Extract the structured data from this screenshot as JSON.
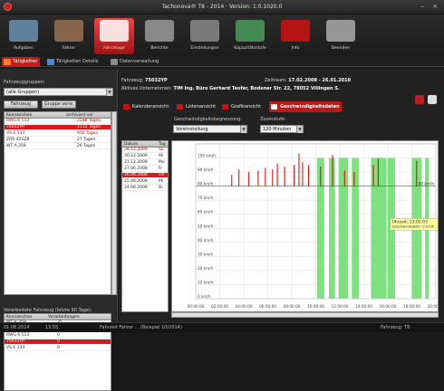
{
  "titlebar": {
    "title": "Tachonova® T8 - 2014 · Version: 1.0.1020.0"
  },
  "toolbar": [
    {
      "label": "Aufgaben",
      "color": "#6a8fb0"
    },
    {
      "label": "Fahrer",
      "color": "#9a7050"
    },
    {
      "label": "Fahrzeuge",
      "color": "#ffffff"
    },
    {
      "label": "Berichte",
      "color": "#9a9a9a"
    },
    {
      "label": "Einstellungen",
      "color": "#8a8a8a"
    },
    {
      "label": "Kapazitätsstufe",
      "color": "#4a9a5a"
    },
    {
      "label": "Info",
      "color": "#d01010"
    },
    {
      "label": "Beenden",
      "color": "#aaaaaa"
    }
  ],
  "tabs": [
    {
      "label": "Tätigkeiten",
      "color": "#ff7a2a"
    },
    {
      "label": "Tätigkeiten Details",
      "color": "#4a8ad0"
    },
    {
      "label": "Datenverwaltung",
      "color": "#8a8a8a"
    }
  ],
  "left": {
    "group_label": "Fahrzeuggruppen:",
    "group_value": "(alle Gruppen)",
    "btn_vehicle": "Fahrzeug verw.",
    "btn_group": "Gruppe verw.",
    "col1": "Kennzeichen",
    "col2": "archiviert vor",
    "vehicles": [
      {
        "plate": "RWG 6 513",
        "age": "2288 Tagen",
        "state": "red"
      },
      {
        "plate": "75032YP",
        "age": "1112 Tagen",
        "state": "sel"
      },
      {
        "plate": "VS E 133",
        "age": "956 Tagen",
        "state": "red"
      },
      {
        "plate": "ZRR 42SZB",
        "age": "27 Tagen",
        "state": ""
      },
      {
        "plate": "WT A 358",
        "age": "26 Tagen",
        "state": ""
      }
    ],
    "recent_label": "Verarbeitete Fahrzeug (letzte 90 Tage):",
    "rcol1": "Kennzeichen",
    "rcol2": "Verarbeitungen",
    "recent": [
      {
        "plate": "WT A 358",
        "count": "35",
        "state": ""
      },
      {
        "plate": "ZRR 42SZB",
        "count": "17",
        "state": ""
      },
      {
        "plate": "RWG 6 513",
        "count": "0",
        "state": ""
      },
      {
        "plate": "75032YP",
        "count": "0",
        "state": "sel"
      },
      {
        "plate": "VS E 133",
        "count": "0",
        "state": ""
      }
    ]
  },
  "main": {
    "vehicle_label": "Fahrzeug:",
    "vehicle_value": "75032YP",
    "zeitraum_label": "Zeitraum:",
    "zeitraum_value": "17.02.2008 - 26.01.2010",
    "company_label": "Aktives Unternehmen:",
    "company_value": "TIM Ing. Büro Gerhard Teofer, Bodener Str. 22, 78052 Villingen S.",
    "views": [
      {
        "label": "Kalenderansicht",
        "color": "#d01010"
      },
      {
        "label": "Listenansicht",
        "color": "#d01010"
      },
      {
        "label": "Grafikansicht",
        "color": "#d01010"
      },
      {
        "label": "Geschwindigkeitsdaten",
        "color": "#ffffff"
      }
    ],
    "speed_label": "Geschwindigkeitsbegrenzung:",
    "speed_value": "Voreinstellung",
    "zoom_label": "Zoomstufe:",
    "zoom_value": "120 Minuten",
    "dates_col1": "Datum",
    "dates_col2": "Tag",
    "dates": [
      {
        "date": "28.12.2009",
        "day": "So",
        "state": "red"
      },
      {
        "date": "30.12.2009",
        "day": "Mi",
        "state": ""
      },
      {
        "date": "21.12.2009",
        "day": "Mo",
        "state": ""
      },
      {
        "date": "27.06.2008",
        "day": "Fr",
        "state": ""
      },
      {
        "date": "26.06.2008",
        "day": "Do",
        "state": "sel"
      },
      {
        "date": "25.06.2008",
        "day": "Mi",
        "state": ""
      },
      {
        "date": "24.06.2008",
        "day": "Di",
        "state": ""
      }
    ]
  },
  "chart_data": {
    "type": "area",
    "x": [
      "00:00:00",
      "02:00:00",
      "04:00:00",
      "06:00:00",
      "08:00:00",
      "10:00:00",
      "12:00:00",
      "14:00:00",
      "16:00:00",
      "18:00:00",
      "20:00:00"
    ],
    "y_ticks": [
      "0 km/h",
      "10 km/h",
      "20 km/h",
      "30 km/h",
      "40 km/h",
      "50 km/h",
      "60 km/h",
      "70 km/h",
      "80 km/h",
      "90 km/h",
      "100 km/h"
    ],
    "ylim": [
      0,
      110
    ],
    "limit_label": "80 km/h",
    "limit_value": 80,
    "active_periods": [
      [
        5.05,
        5.35
      ],
      [
        5.55,
        5.8
      ],
      [
        5.95,
        6.35
      ],
      [
        6.5,
        6.8
      ],
      [
        7.3,
        7.95
      ],
      [
        8.0,
        8.3
      ],
      [
        9.0,
        9.4
      ],
      [
        9.55,
        9.7
      ],
      [
        10.35,
        10.8
      ],
      [
        11.35,
        11.7
      ],
      [
        12.0,
        12.4
      ]
    ],
    "speed_spikes": [
      [
        1.5,
        88
      ],
      [
        1.8,
        92
      ],
      [
        2.2,
        90
      ],
      [
        2.6,
        91
      ],
      [
        2.9,
        93
      ],
      [
        3.2,
        92
      ],
      [
        3.4,
        96
      ],
      [
        3.7,
        94
      ],
      [
        4.1,
        95
      ],
      [
        4.3,
        103
      ],
      [
        4.45,
        97
      ],
      [
        4.7,
        95
      ],
      [
        5.2,
        94
      ],
      [
        5.7,
        102
      ],
      [
        6.2,
        91
      ],
      [
        6.6,
        90
      ],
      [
        7.4,
        95
      ],
      [
        7.6,
        100
      ],
      [
        9.2,
        98
      ],
      [
        10.5,
        94
      ],
      [
        12.1,
        91
      ]
    ],
    "tooltip_time": "Uhrzeit: 13:02:03",
    "tooltip_text": "Geschwindigkeit: 0 km/h",
    "colors": {
      "active": "#7fe07f",
      "line": "#cc0000",
      "limit": "#cc0000"
    }
  },
  "status": {
    "left": "01.06.2014",
    "time": "13:55",
    "center": "Fahrzeit Fahrer ... (Beispiel 10/2014)",
    "right": "Fahrzeug: T8"
  }
}
